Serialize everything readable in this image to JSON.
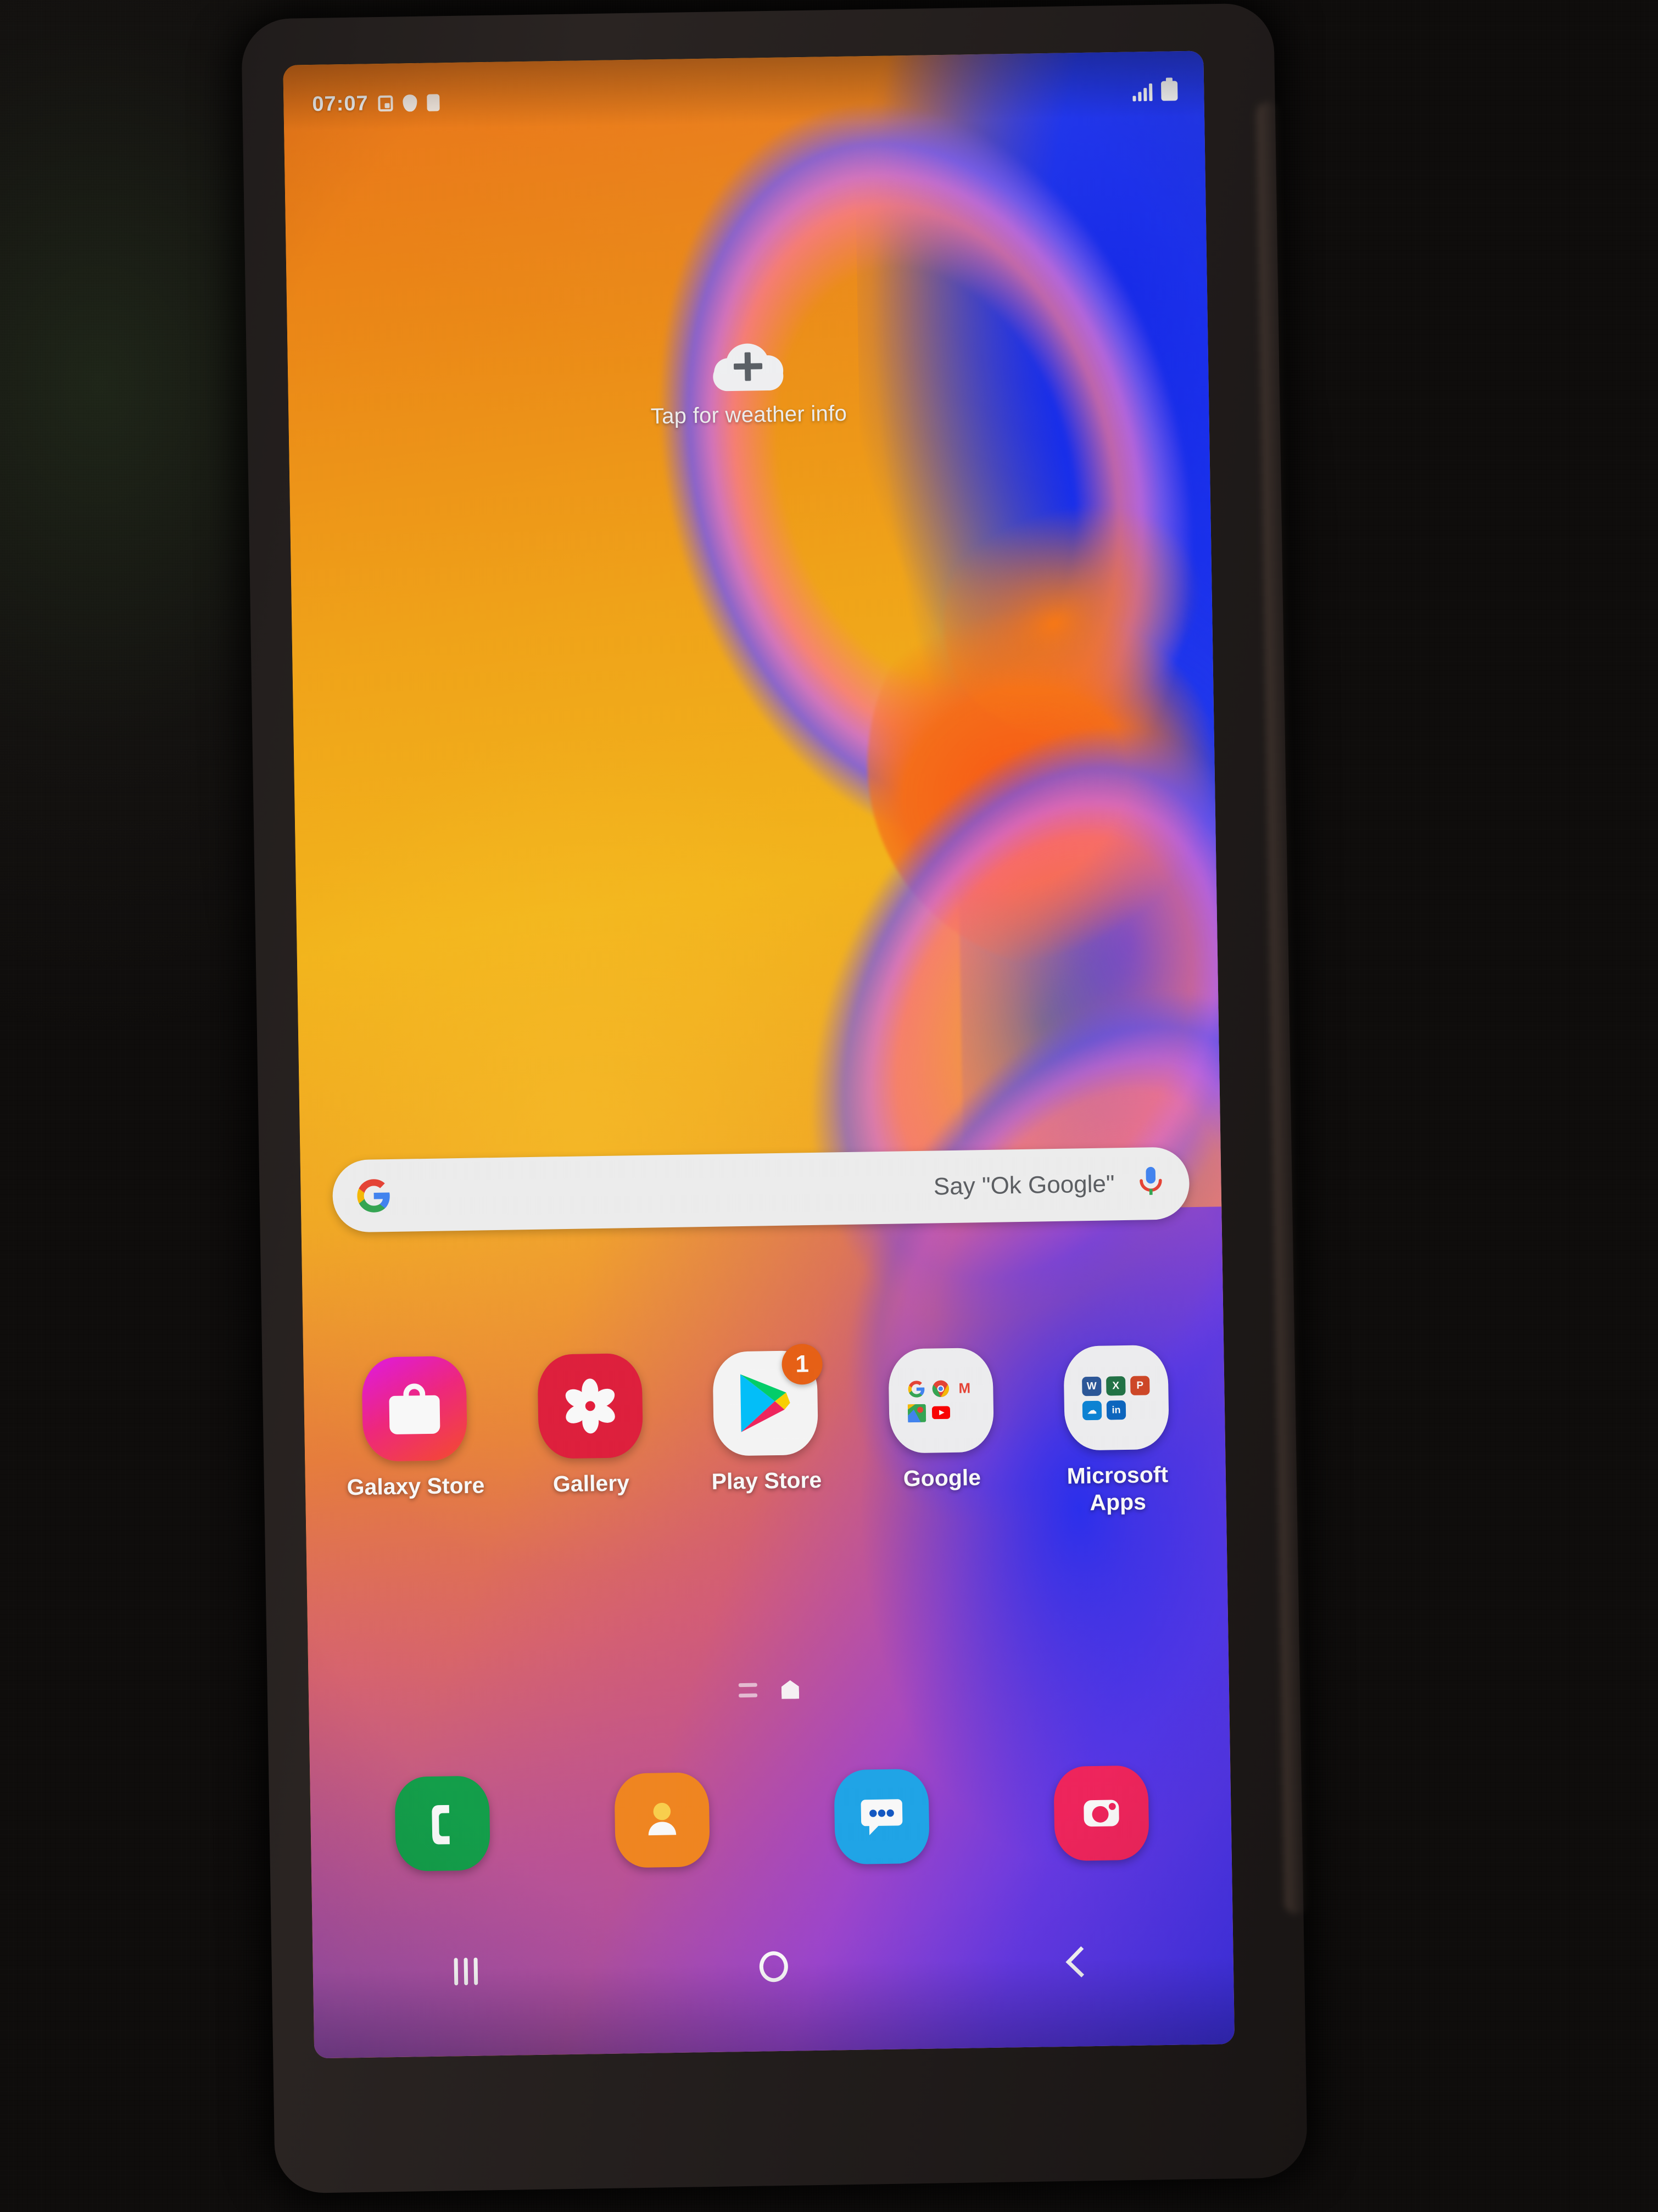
{
  "device": {
    "kind": "smartphone-photo",
    "screen_bg_note": "samsung-galaxy-flow-wallpaper"
  },
  "status_bar": {
    "clock": "07:07",
    "left_icons": [
      "screenshot-icon",
      "shield-icon",
      "sim-card-icon"
    ],
    "right_icons": [
      "signal-bars-icon",
      "battery-icon"
    ]
  },
  "weather_widget": {
    "icon": "cloud-plus-icon",
    "text": "Tap for weather info"
  },
  "search": {
    "logo": "google-g-icon",
    "placeholder": "Say \"Ok Google\"",
    "mic": "microphone-icon"
  },
  "apps": [
    {
      "label": "Galaxy Store",
      "icon": "galaxy-store-icon",
      "badge": ""
    },
    {
      "label": "Gallery",
      "icon": "gallery-icon",
      "badge": ""
    },
    {
      "label": "Play Store",
      "icon": "play-store-icon",
      "badge": "1"
    },
    {
      "label": "Google",
      "icon": "google-folder-icon",
      "badge": "",
      "folder_items": [
        "Google",
        "Chrome",
        "Gmail",
        "Maps",
        "YouTube"
      ]
    },
    {
      "label": "Microsoft Apps",
      "icon": "microsoft-folder-icon",
      "badge": "",
      "folder_items": [
        "Word",
        "Excel",
        "PowerPoint",
        "OneDrive",
        "LinkedIn"
      ]
    }
  ],
  "page_indicator": {
    "items": [
      "apps-list-page",
      "home-page"
    ],
    "active_index": 1
  },
  "dock": [
    {
      "label": "Phone",
      "icon": "phone-icon"
    },
    {
      "label": "Contacts",
      "icon": "contacts-icon"
    },
    {
      "label": "Messages",
      "icon": "messages-icon"
    },
    {
      "label": "Camera",
      "icon": "camera-icon"
    }
  ],
  "nav_bar": [
    {
      "label": "Recents",
      "icon": "recents-icon"
    },
    {
      "label": "Home",
      "icon": "home-icon"
    },
    {
      "label": "Back",
      "icon": "back-icon"
    }
  ],
  "colors": {
    "badge": "#ec6114",
    "galaxy_store_a": "#e418e8",
    "galaxy_store_b": "#fb4b2c",
    "gallery": "#e31e3c",
    "phone": "#11a14a",
    "contacts": "#f6871f",
    "messages": "#1ea7ec",
    "camera": "#f4235c",
    "wallpaper_warm": "#f6a617",
    "wallpaper_cool": "#2a2ef2"
  }
}
